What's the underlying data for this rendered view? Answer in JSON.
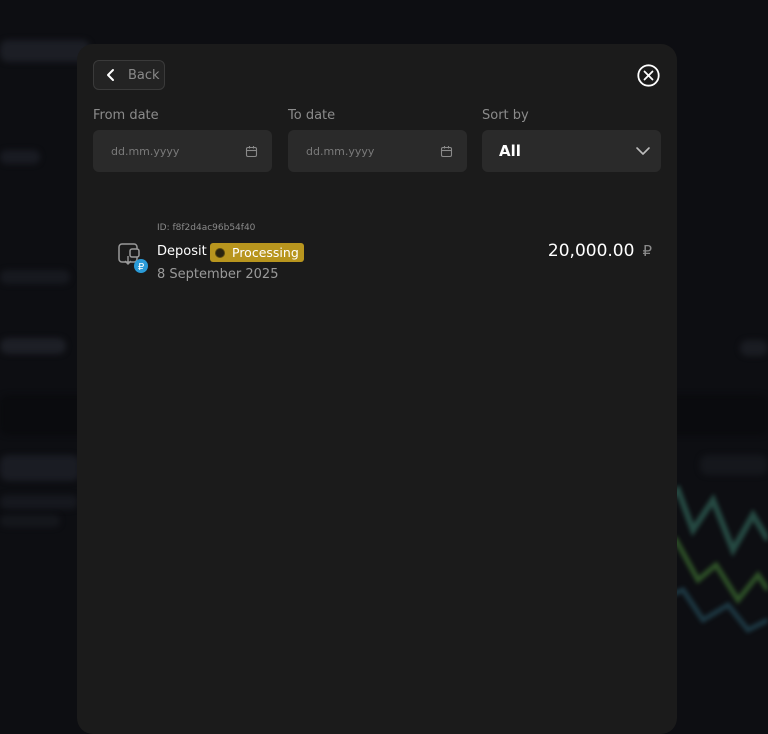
{
  "header": {
    "back_label": "Back"
  },
  "filters": {
    "from_label": "From date",
    "from_placeholder": "dd.mm.yyyy",
    "to_label": "To date",
    "to_placeholder": "dd.mm.yyyy",
    "sort_label": "Sort by",
    "sort_value": "All"
  },
  "transactions": [
    {
      "id": "ID: f8f2d4ac96b54f40",
      "type": "Deposit",
      "status": "Processing",
      "date": "8 September 2025",
      "amount": "20,000.00",
      "currency": "₽"
    }
  ],
  "colors": {
    "modal_bg": "#1b1b1b",
    "input_bg": "#2a2a2a",
    "status_processing": "#b8951e",
    "currency_badge": "#2a9bd8"
  },
  "icons": {
    "back": "chevron-left-icon",
    "close": "close-circle-icon",
    "calendar": "calendar-icon",
    "dropdown": "chevron-down-icon",
    "transaction": "wallet-deposit-icon"
  }
}
